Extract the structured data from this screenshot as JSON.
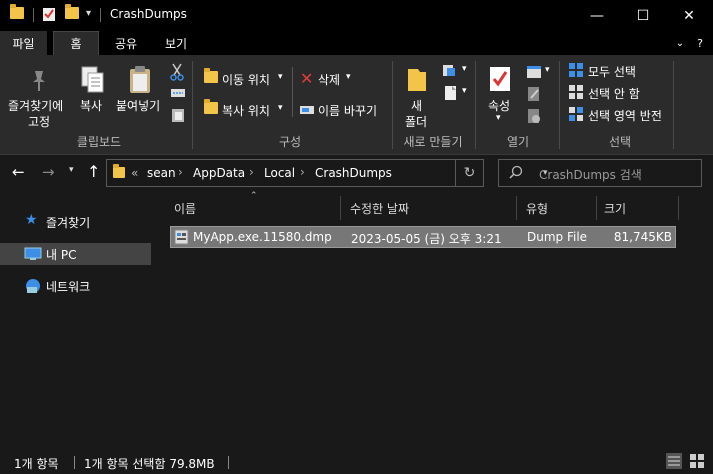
{
  "window": {
    "title": "CrashDumps",
    "minimize_glyph": "—",
    "maximize_glyph": "☐",
    "close_glyph": "✕"
  },
  "ribbon_tabs": [
    "파일",
    "홈",
    "공유",
    "보기"
  ],
  "ribbon": {
    "clipboard": {
      "pin_label_line1": "즐겨찾기에",
      "pin_label_line2": "고정",
      "copy_label": "복사",
      "paste_label": "붙여넣기",
      "group_label": "클립보드"
    },
    "organize": {
      "move_to": "이동 위치",
      "copy_to": "복사 위치",
      "delete": "삭제",
      "rename": "이름 바꾸기",
      "group_label": "구성"
    },
    "new": {
      "new_folder_line1": "새",
      "new_folder_line2": "폴더",
      "group_label": "새로 만들기"
    },
    "open": {
      "properties": "속성",
      "group_label": "열기"
    },
    "select": {
      "select_all": "모두 선택",
      "select_none": "선택 안 함",
      "invert_selection": "선택 영역 반전",
      "group_label": "선택"
    }
  },
  "address": {
    "overflow": "«",
    "crumbs": [
      "sean",
      "AppData",
      "Local",
      "CrashDumps"
    ],
    "search_placeholder": "CrashDumps 검색"
  },
  "nav_pane": {
    "items": [
      {
        "label": "즐겨찾기",
        "icon": "star-icon"
      },
      {
        "label": "내 PC",
        "icon": "pc-icon"
      },
      {
        "label": "네트워크",
        "icon": "network-icon"
      }
    ]
  },
  "file_list": {
    "columns": [
      "이름",
      "수정한 날짜",
      "유형",
      "크기"
    ],
    "rows": [
      {
        "name": "MyApp.exe.11580.dmp",
        "modified": "2023-05-05 (금) 오후 3:21",
        "type": "Dump File",
        "size": "81,745KB"
      }
    ]
  },
  "status": {
    "item_count": "1개 항목",
    "selected": "1개 항목 선택함 79.8MB"
  },
  "colors": {
    "accent_blue": "#3c8ee6",
    "folder_yellow": "#f3c44a",
    "selected_row": "#777777"
  }
}
